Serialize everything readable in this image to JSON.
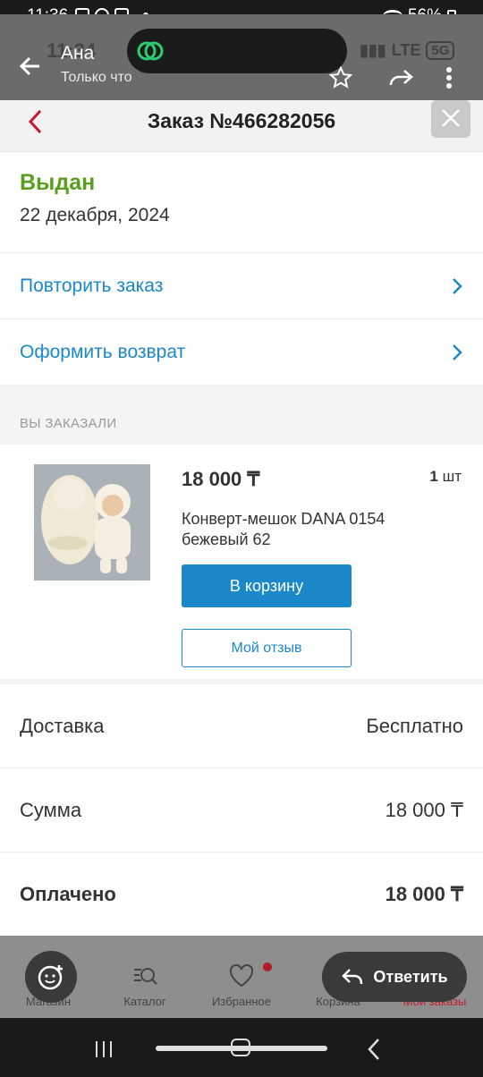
{
  "status_bar": {
    "time": "11:36",
    "battery": "56%"
  },
  "notification": {
    "sender": "Ана",
    "subtitle": "Только что",
    "ghost_time": "11:34",
    "network": "LTE",
    "network_badge": "5G"
  },
  "order": {
    "title": "Заказ №466282056",
    "status": "Выдан",
    "date": "22 декабря, 2024",
    "actions": [
      {
        "label": "Повторить заказ"
      },
      {
        "label": "Оформить возврат"
      }
    ],
    "section_title": "ВЫ ЗАКАЗАЛИ",
    "item": {
      "price": "18 000 ₸",
      "qty_number": "1",
      "qty_unit": "шт",
      "name": "Конверт-мешок DANA 0154 бежевый 62",
      "cart_button": "В корзину",
      "review_button": "Мой отзыв"
    },
    "summary": [
      {
        "label": "Доставка",
        "value": "Бесплатно"
      },
      {
        "label": "Сумма",
        "value": "18 000 ₸"
      },
      {
        "label": "Оплачено",
        "value": "18 000 ₸"
      }
    ]
  },
  "bottom_nav": {
    "items": [
      {
        "label": "Магазин",
        "icon": "shop-icon"
      },
      {
        "label": "Каталог",
        "icon": "catalog-search-icon"
      },
      {
        "label": "Избранное",
        "icon": "heart-icon"
      },
      {
        "label": "Корзина",
        "icon": "cart-icon"
      },
      {
        "label": "Мои заказы",
        "icon": "orders-icon",
        "active": true
      }
    ],
    "reply_label": "Ответить"
  },
  "colors": {
    "accent_blue": "#1a88c9",
    "status_green": "#5a9e1f",
    "active_red": "#c41c2e"
  }
}
